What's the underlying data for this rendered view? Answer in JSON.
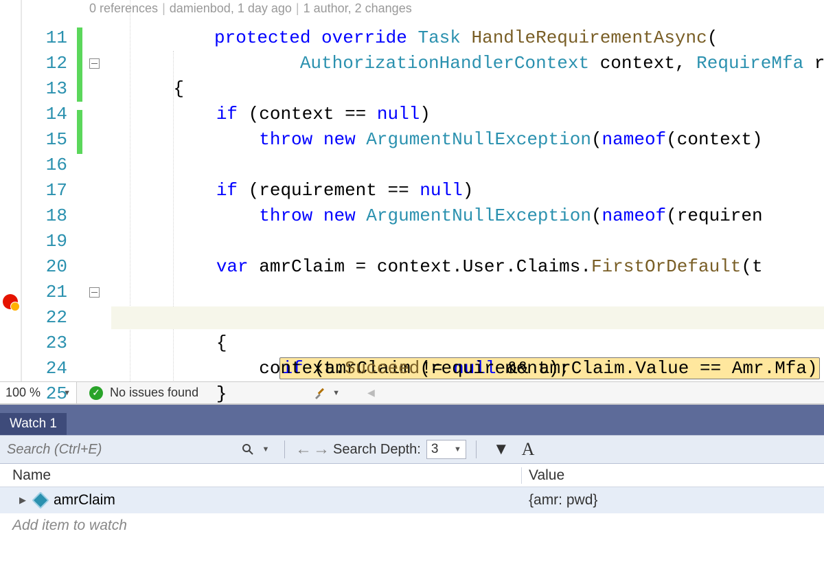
{
  "codelens": {
    "refs": "0 references",
    "author": "damienbod, 1 day ago",
    "changes": "1 author, 2 changes"
  },
  "lines": {
    "l11": "11",
    "l12": "12",
    "l13": "13",
    "l14": "14",
    "l15": "15",
    "l16": "16",
    "l17": "17",
    "l18": "18",
    "l19": "19",
    "l20": "20",
    "l21": "21",
    "l22": "22",
    "l23": "23",
    "l24": "24",
    "l25": "25"
  },
  "code": {
    "l11": {
      "kw1": "protected ",
      "kw2": "override ",
      "type": "Task ",
      "meth": "HandleRequirementAsync",
      "rest": "("
    },
    "l12": {
      "indent": "        ",
      "type1": "AuthorizationHandlerContext ",
      "p1": "context, ",
      "type2": "RequireMfa ",
      "p2": "rec"
    },
    "l13": {
      "indent": "    ",
      "brace": "{"
    },
    "l14": {
      "indent": "        ",
      "kw": "if ",
      "rest": "(context == ",
      "kw2": "null",
      "rest2": ")"
    },
    "l15": {
      "indent": "            ",
      "kw": "throw ",
      "kw2": "new ",
      "type": "ArgumentNullException",
      "rest": "(",
      "kw3": "nameof",
      "rest2": "(context)"
    },
    "l17": {
      "indent": "        ",
      "kw": "if ",
      "rest": "(requirement == ",
      "kw2": "null",
      "rest2": ")"
    },
    "l18": {
      "indent": "            ",
      "kw": "throw ",
      "kw2": "new ",
      "type": "ArgumentNullException",
      "rest": "(",
      "kw3": "nameof",
      "rest2": "(requiren"
    },
    "l20": {
      "indent": "        ",
      "kw": "var ",
      "rest": "amrClaim = context.User.Claims.",
      "meth": "FirstOrDefault",
      "rest2": "(t"
    },
    "l22": {
      "indent": "        ",
      "kw": "if ",
      "rest": "(amrClaim != ",
      "kw2": "null ",
      "rest2": "&& amrClaim.Value == Amr.Mfa)"
    },
    "l23": {
      "indent": "        ",
      "brace": "{"
    },
    "l24": {
      "indent": "            ",
      "call": "context.",
      "meth": "Succeed",
      "rest": "(requirement);"
    },
    "l25": {
      "indent": "        ",
      "brace": "}"
    }
  },
  "status": {
    "zoom": "100 %",
    "issues": "No issues found"
  },
  "watch": {
    "tab": "Watch 1",
    "search_placeholder": "Search (Ctrl+E)",
    "depth_label": "Search Depth:",
    "depth_value": "3",
    "col_name": "Name",
    "col_value": "Value",
    "rows": [
      {
        "name": "amrClaim",
        "value": "{amr: pwd}"
      }
    ],
    "add_placeholder": "Add item to watch"
  }
}
